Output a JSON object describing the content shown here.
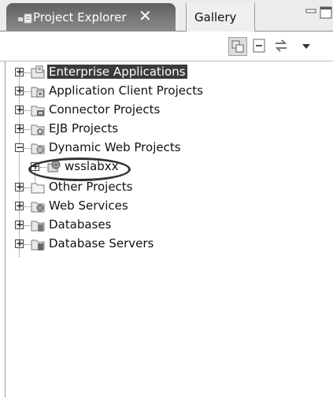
{
  "view": {
    "tabs": [
      {
        "label": "Project Explorer",
        "active": true,
        "close_glyph": "✕"
      },
      {
        "label": "Gallery",
        "active": false
      }
    ],
    "window_controls": [
      "minimize-icon",
      "maximize-icon"
    ]
  },
  "toolbar": {
    "buttons": [
      "link-with-editor-icon",
      "collapse-all-icon",
      "sync-icon",
      "view-menu-icon"
    ]
  },
  "tree": {
    "items": [
      {
        "label": "Enterprise Applications",
        "icon": "enterprise-app-folder-icon",
        "expanded": false,
        "selected": true
      },
      {
        "label": "Application Client Projects",
        "icon": "app-client-folder-icon",
        "expanded": false
      },
      {
        "label": "Connector Projects",
        "icon": "connector-folder-icon",
        "expanded": false
      },
      {
        "label": "EJB Projects",
        "icon": "ejb-folder-icon",
        "expanded": false
      },
      {
        "label": "Dynamic Web Projects",
        "icon": "web-folder-icon",
        "expanded": true
      },
      {
        "label": "wsslabxx",
        "icon": "web-project-icon",
        "expanded": false,
        "child": true
      },
      {
        "label": "Other Projects",
        "icon": "folder-icon",
        "expanded": false
      },
      {
        "label": "Web Services",
        "icon": "web-services-folder-icon",
        "expanded": false
      },
      {
        "label": "Databases",
        "icon": "database-folder-icon",
        "expanded": false
      },
      {
        "label": "Database Servers",
        "icon": "database-server-folder-icon",
        "expanded": false
      }
    ]
  },
  "colors": {
    "active_tab": "#6a6a6a",
    "selection": "#3a3a3a",
    "annotation_ring": "#333333"
  }
}
